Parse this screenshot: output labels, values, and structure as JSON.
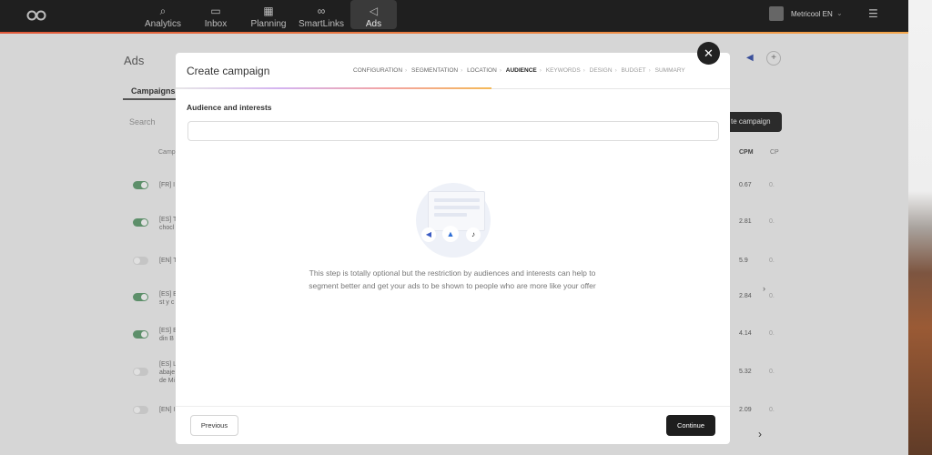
{
  "nav": {
    "items": [
      {
        "label": "Analytics",
        "icon": "search-chart-icon"
      },
      {
        "label": "Inbox",
        "icon": "chat-icon"
      },
      {
        "label": "Planning",
        "icon": "calendar-icon"
      },
      {
        "label": "SmartLinks",
        "icon": "link-icon"
      },
      {
        "label": "Ads",
        "icon": "megaphone-icon"
      }
    ],
    "active": "Ads",
    "account_name": "Metricool EN"
  },
  "background_page": {
    "title": "Ads",
    "tab": "Campaigns",
    "search_placeholder": "Search",
    "create_button": "te campaign",
    "col_campaign": "Camp",
    "col_cpm": "CPM",
    "col_next": "CP",
    "rows": [
      {
        "name": "[FR] I",
        "active": true,
        "cpm": "0.67"
      },
      {
        "name": "[ES] T chocl",
        "active": true,
        "cpm": "2.81"
      },
      {
        "name": "[EN] T",
        "active": false,
        "cpm": "5.9"
      },
      {
        "name": "[ES] E st y c",
        "active": true,
        "cpm": "2.84"
      },
      {
        "name": "[ES] E din B",
        "active": true,
        "cpm": "4.14"
      },
      {
        "name": "[ES] L abaje de Mi",
        "active": false,
        "cpm": "5.32"
      },
      {
        "name": "[EN] I",
        "active": false,
        "cpm": "2.09"
      }
    ],
    "row_trailing": "0."
  },
  "modal": {
    "title": "Create campaign",
    "steps": [
      {
        "label": "CONFIGURATION",
        "state": "done"
      },
      {
        "label": "SEGMENTATION",
        "state": "done"
      },
      {
        "label": "LOCATION",
        "state": "done"
      },
      {
        "label": "AUDIENCE",
        "state": "current"
      },
      {
        "label": "KEYWORDS",
        "state": "todo"
      },
      {
        "label": "DESIGN",
        "state": "todo"
      },
      {
        "label": "BUDGET",
        "state": "todo"
      },
      {
        "label": "SUMMARY",
        "state": "todo"
      }
    ],
    "section_label": "Audience and interests",
    "audience_input_value": "",
    "helper_line1": "This step is totally optional but the restriction by audiences and interests can help to",
    "helper_line2": "segment better and get your ads to be shown to people who are more like your offer",
    "previous_button": "Previous",
    "continue_button": "Continue",
    "close_symbol": "✕"
  },
  "colors": {
    "topbar": "#1f1f1f",
    "accent_orange": "#f3a64b",
    "toggle_on": "#5d8f6a",
    "primary_button": "#1e1e1e"
  }
}
